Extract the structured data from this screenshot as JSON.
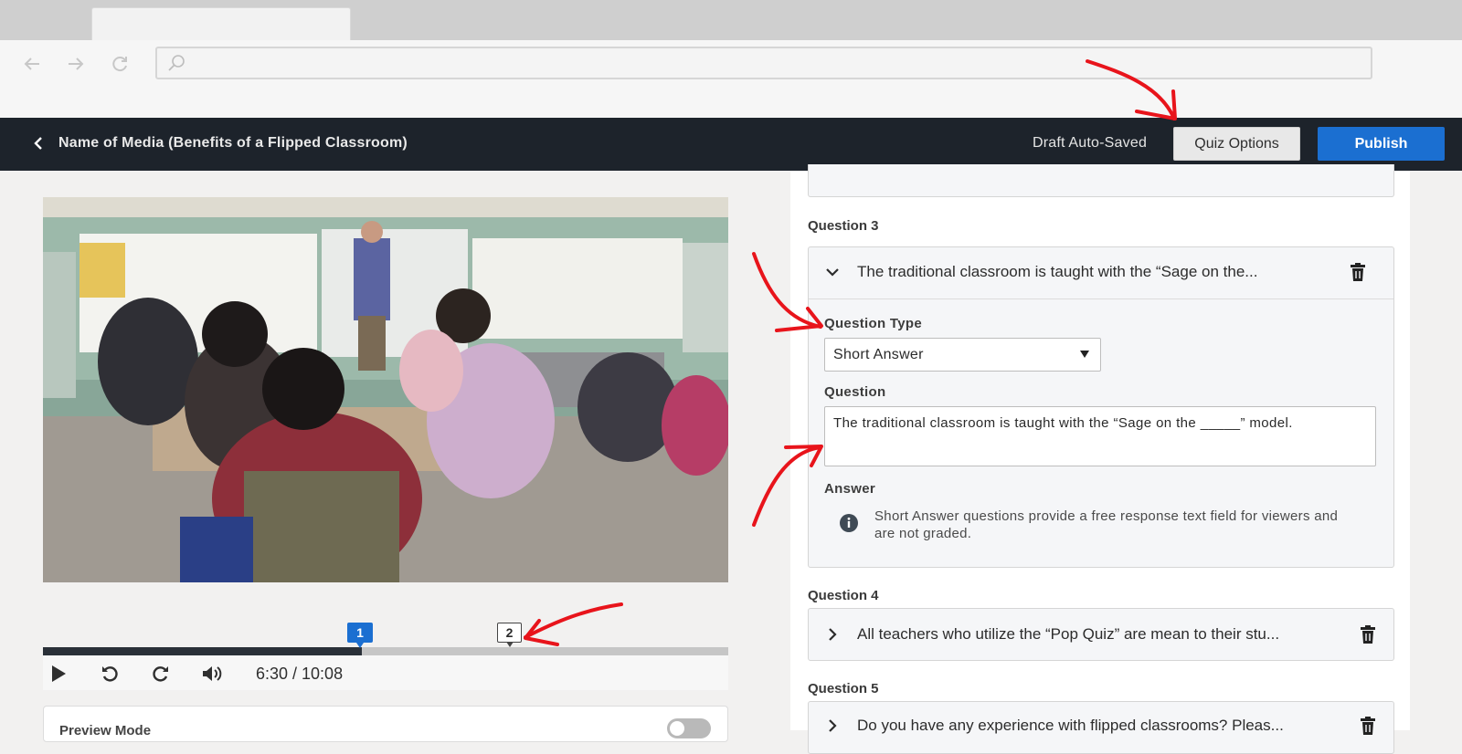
{
  "browser": {
    "url": ""
  },
  "header": {
    "media_title": "Name of Media (Benefits of a Flipped Classroom)",
    "draft_status": "Draft Auto-Saved",
    "quiz_options_label": "Quiz Options",
    "publish_label": "Publish"
  },
  "player": {
    "time_display": "6:30 / 10:08",
    "progress": 0.465,
    "markers": [
      {
        "label": "1",
        "active": true
      },
      {
        "label": "2",
        "active": false
      }
    ],
    "preview_mode_label": "Preview Mode",
    "preview_mode_on": false
  },
  "questions": [
    {
      "heading": "Question 3",
      "summary": "The traditional classroom is taught with the “Sage on the...",
      "expanded": true,
      "type_label": "Question Type",
      "type_value": "Short Answer",
      "question_label": "Question",
      "question_text": "The traditional classroom is taught with the “Sage on the _____” model.",
      "answer_label": "Answer",
      "answer_info": "Short Answer questions provide a free response text field for viewers and are not graded."
    },
    {
      "heading": "Question 4",
      "summary": "All teachers who utilize the “Pop Quiz” are mean to their stu...",
      "expanded": false
    },
    {
      "heading": "Question 5",
      "summary": "Do you have any experience with flipped classrooms? Pleas...",
      "expanded": false
    }
  ],
  "colors": {
    "appbar": "#1d232b",
    "accent": "#1b6fd1",
    "annotation": "#e8141b"
  }
}
